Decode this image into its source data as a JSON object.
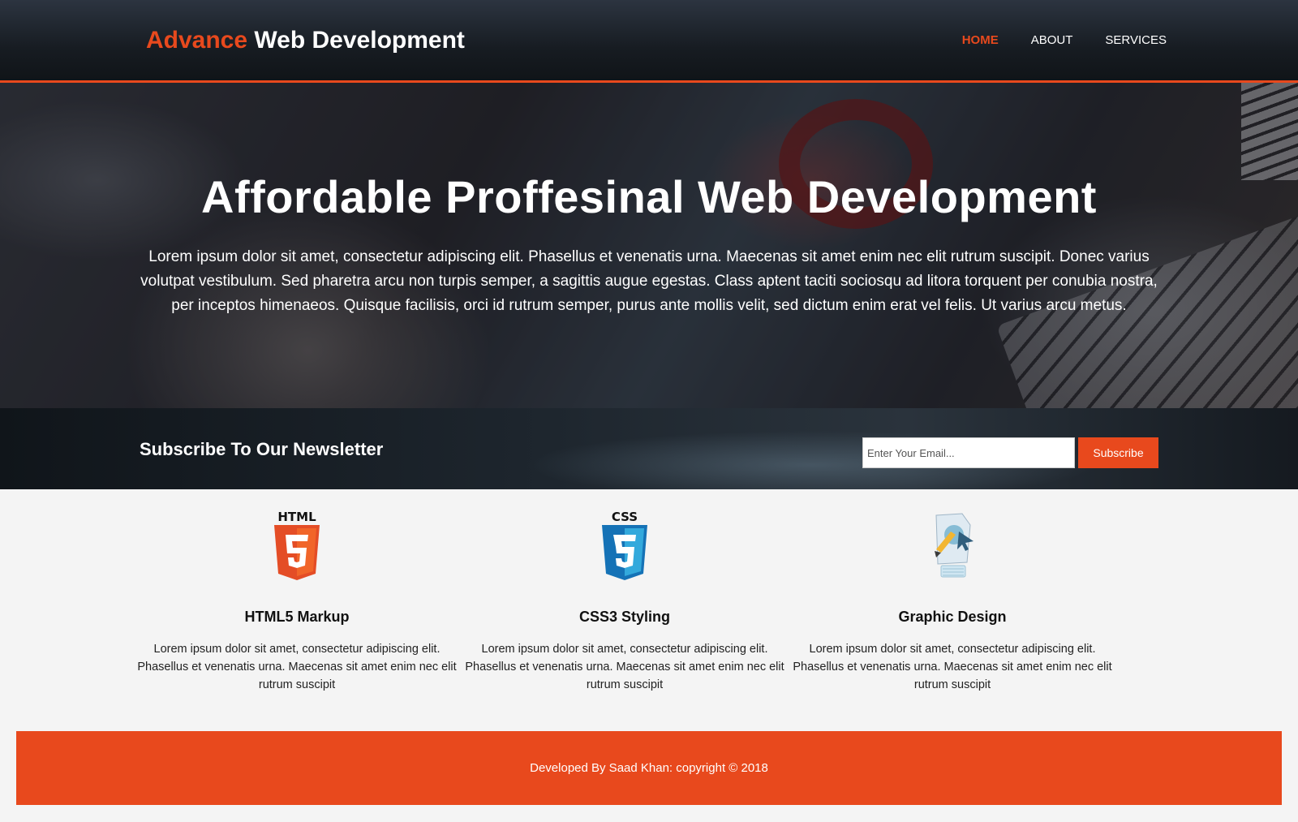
{
  "header": {
    "logo_accent": "Advance",
    "logo_rest": " Web Development",
    "nav": [
      {
        "label": "HOME",
        "active": true
      },
      {
        "label": "ABOUT",
        "active": false
      },
      {
        "label": "SERVICES",
        "active": false
      }
    ]
  },
  "hero": {
    "title": "Affordable Proffesinal Web Development",
    "text": "Lorem ipsum dolor sit amet, consectetur adipiscing elit. Phasellus et venenatis urna. Maecenas sit amet enim nec elit rutrum suscipit. Donec varius volutpat vestibulum. Sed pharetra arcu non turpis semper, a sagittis augue egestas. Class aptent taciti sociosqu ad litora torquent per conubia nostra, per inceptos himenaeos. Quisque facilisis, orci id rutrum semper, purus ante mollis velit, sed dictum enim erat vel felis. Ut varius arcu metus."
  },
  "newsletter": {
    "title": "Subscribe To Our Newsletter",
    "email_placeholder": "Enter Your Email...",
    "button_label": "Subscribe"
  },
  "boxes": [
    {
      "icon": "html5-icon",
      "title": "HTML5 Markup",
      "text": "Lorem ipsum dolor sit amet, consectetur adipiscing elit. Phasellus et venenatis urna. Maecenas sit amet enim nec elit rutrum suscipit"
    },
    {
      "icon": "css3-icon",
      "title": "CSS3 Styling",
      "text": "Lorem ipsum dolor sit amet, consectetur adipiscing elit. Phasellus et venenatis urna. Maecenas sit amet enim nec elit rutrum suscipit"
    },
    {
      "icon": "graphic-design-icon",
      "title": "Graphic Design",
      "text": "Lorem ipsum dolor sit amet, consectetur adipiscing elit. Phasellus et venenatis urna. Maecenas sit amet enim nec elit rutrum suscipit"
    }
  ],
  "footer": {
    "text": "Developed By Saad Khan: copyright © 2018"
  },
  "icon_labels": {
    "html": "HTML",
    "css": "CSS"
  },
  "colors": {
    "accent": "#e8491d",
    "html5_orange": "#e44d26",
    "css3_blue": "#1572b6"
  }
}
